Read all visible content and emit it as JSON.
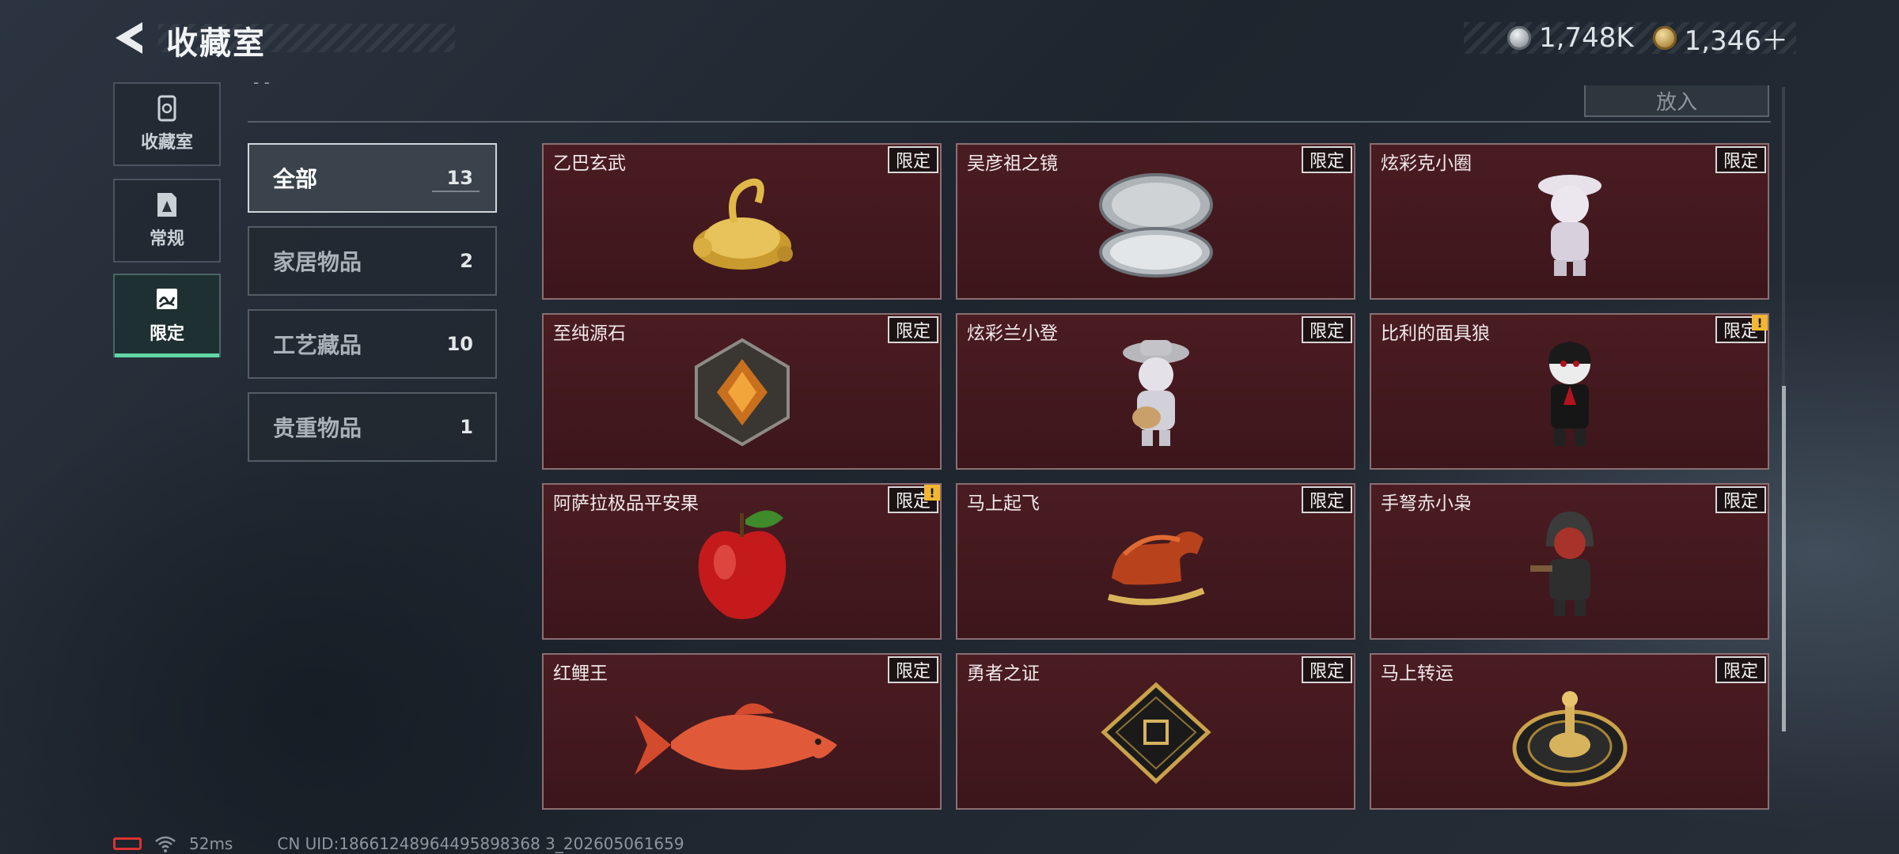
{
  "header": {
    "title": "收藏室",
    "currencies": [
      {
        "icon": "silver-coin-icon",
        "value": "1,748K"
      },
      {
        "icon": "gold-coin-icon",
        "value": "1,346＋"
      }
    ]
  },
  "sidebar": {
    "items": [
      {
        "label": "收藏室",
        "icon": "collection-icon",
        "active": false
      },
      {
        "label": "常规",
        "icon": "document-icon",
        "active": false
      },
      {
        "label": "限定",
        "icon": "limited-icon",
        "active": true
      }
    ]
  },
  "toolbar": {
    "put_label": "放入",
    "faded_text": "- -"
  },
  "categories": [
    {
      "label": "全部",
      "count": "13",
      "active": true
    },
    {
      "label": "家居物品",
      "count": "2",
      "active": false
    },
    {
      "label": "工艺藏品",
      "count": "10",
      "active": false
    },
    {
      "label": "贵重物品",
      "count": "1",
      "active": false
    }
  ],
  "items": [
    {
      "name": "乙巴玄武",
      "tag": "限定",
      "art": "gold-tortoise-icon",
      "alert": false
    },
    {
      "name": "吴彦祖之镜",
      "tag": "限定",
      "art": "compact-mirror-icon",
      "alert": false
    },
    {
      "name": "炫彩克小圈",
      "tag": "限定",
      "art": "white-figure-icon",
      "alert": false
    },
    {
      "name": "至纯源石",
      "tag": "限定",
      "art": "crystal-stone-icon",
      "alert": false
    },
    {
      "name": "炫彩兰小登",
      "tag": "限定",
      "art": "guitar-figure-icon",
      "alert": false
    },
    {
      "name": "比利的面具狼",
      "tag": "限定",
      "art": "puppet-figure-icon",
      "alert": true
    },
    {
      "name": "阿萨拉极品平安果",
      "tag": "限定",
      "art": "red-apple-icon",
      "alert": true
    },
    {
      "name": "马上起飞",
      "tag": "限定",
      "art": "bronze-horse-icon",
      "alert": false
    },
    {
      "name": "手弩赤小枭",
      "tag": "限定",
      "art": "hooded-figure-icon",
      "alert": false
    },
    {
      "name": "红鲤王",
      "tag": "限定",
      "art": "red-carp-icon",
      "alert": false
    },
    {
      "name": "勇者之证",
      "tag": "限定",
      "art": "black-card-icon",
      "alert": false
    },
    {
      "name": "马上转运",
      "tag": "限定",
      "art": "gold-compass-icon",
      "alert": false
    }
  ],
  "alert_mark": "!",
  "footer": {
    "ping": "52ms",
    "uid": "CN UID:18661248964495898368 3_202605061659"
  },
  "colors": {
    "accent": "#5fd6a4",
    "card_bg": "#4a1c22",
    "card_border": "#8a6f73",
    "alert": "#f2b632"
  }
}
